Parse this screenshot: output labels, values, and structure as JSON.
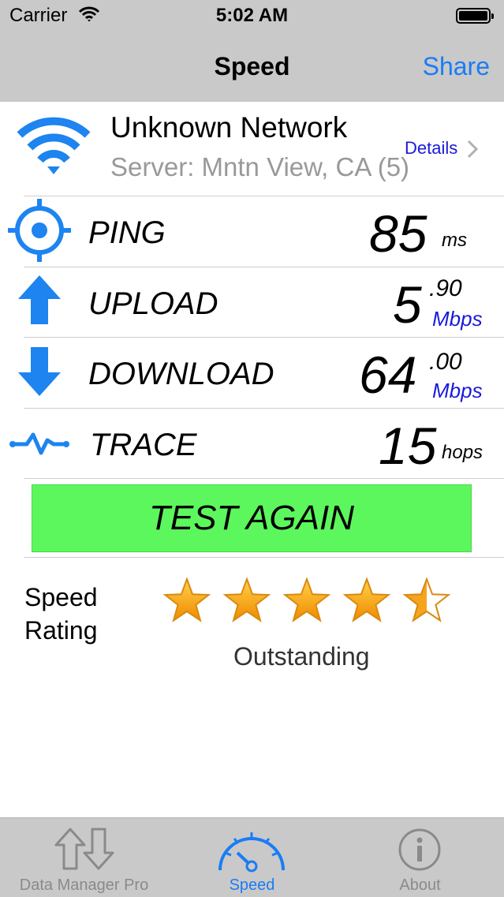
{
  "status_bar": {
    "carrier": "Carrier",
    "time": "5:02 AM"
  },
  "nav": {
    "title": "Speed",
    "share_label": "Share"
  },
  "network": {
    "name": "Unknown Network",
    "server": "Server: Mntn View, CA (5)",
    "details_label": "Details"
  },
  "metrics": {
    "ping": {
      "label": "PING",
      "value": "85",
      "unit": "ms"
    },
    "upload": {
      "label": "UPLOAD",
      "value": "5",
      "decimal": ".90",
      "unit": "Mbps"
    },
    "download": {
      "label": "DOWNLOAD",
      "value": "64",
      "decimal": ".00",
      "unit": "Mbps"
    },
    "trace": {
      "label": "TRACE",
      "value": "15",
      "unit": "hops"
    }
  },
  "test_button": {
    "label": "TEST AGAIN"
  },
  "rating": {
    "label_line1": "Speed",
    "label_line2": "Rating",
    "stars": 4.5,
    "max_stars": 5,
    "text": "Outstanding"
  },
  "tabs": [
    {
      "label": "Data Manager Pro",
      "icon": "arrows-up-down-icon",
      "active": false
    },
    {
      "label": "Speed",
      "icon": "speedometer-icon",
      "active": true
    },
    {
      "label": "About",
      "icon": "info-icon",
      "active": false
    }
  ],
  "colors": {
    "accent": "#1a7cf5",
    "icon_blue": "#1d84f0",
    "button_green": "#5cf75c",
    "star_gold": "#f5a41c",
    "unit_blue": "#1a1adb"
  }
}
